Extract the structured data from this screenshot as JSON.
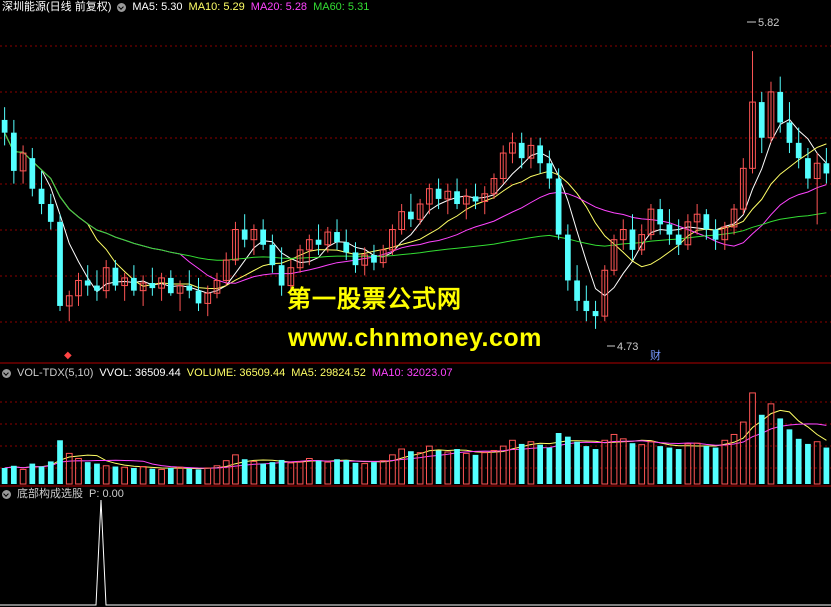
{
  "price_header": {
    "stock": "深圳能源(日线 前复权)",
    "ma5": "MA5: 5.30",
    "ma10": "MA10: 5.29",
    "ma20": "MA20: 5.28",
    "ma60": "MA60: 5.31"
  },
  "volume_header": {
    "indicator": "VOL-TDX(5,10)",
    "vvol": "VVOL: 36509.44",
    "volume": "VOLUME: 36509.44",
    "ma5": "MA5: 29824.52",
    "ma10": "MA10: 32023.07"
  },
  "signal_header": {
    "indicator": "底部构成选股",
    "p": "P: 0.00"
  },
  "annotations": {
    "high": "5.82",
    "low": "4.73",
    "marker": "财"
  },
  "watermark": {
    "line1": "第一股票公式网",
    "line2": "www.chnmoney.com"
  },
  "colors": {
    "up": "#ff5555",
    "down": "#54ffff",
    "ma5": "#ffffff",
    "ma10": "#ffff66",
    "ma20": "#ff44ff",
    "ma60": "#33dd33",
    "grid": "#8b0000"
  },
  "chart_data": [
    {
      "type": "candlestick",
      "ylim": [
        4.6,
        5.95
      ],
      "candles": [
        [
          5.55,
          5.6,
          5.45,
          5.5
        ],
        [
          5.5,
          5.55,
          5.3,
          5.35
        ],
        [
          5.35,
          5.45,
          5.3,
          5.42
        ],
        [
          5.4,
          5.44,
          5.25,
          5.28
        ],
        [
          5.28,
          5.35,
          5.18,
          5.22
        ],
        [
          5.22,
          5.26,
          5.12,
          5.15
        ],
        [
          5.15,
          5.18,
          4.8,
          4.82
        ],
        [
          4.82,
          4.88,
          4.76,
          4.86
        ],
        [
          4.86,
          4.95,
          4.82,
          4.92
        ],
        [
          4.92,
          4.98,
          4.86,
          4.9
        ],
        [
          4.9,
          4.96,
          4.84,
          4.88
        ],
        [
          4.88,
          5.0,
          4.85,
          4.97
        ],
        [
          4.97,
          5.0,
          4.88,
          4.9
        ],
        [
          4.9,
          4.95,
          4.84,
          4.93
        ],
        [
          4.93,
          4.98,
          4.86,
          4.88
        ],
        [
          4.88,
          4.94,
          4.82,
          4.91
        ],
        [
          4.91,
          4.97,
          4.86,
          4.89
        ],
        [
          4.89,
          4.95,
          4.84,
          4.93
        ],
        [
          4.93,
          4.96,
          4.86,
          4.87
        ],
        [
          4.87,
          4.92,
          4.8,
          4.9
        ],
        [
          4.9,
          4.96,
          4.85,
          4.88
        ],
        [
          4.88,
          4.93,
          4.8,
          4.83
        ],
        [
          4.83,
          4.9,
          4.78,
          4.87
        ],
        [
          4.87,
          4.95,
          4.85,
          4.92
        ],
        [
          4.92,
          5.03,
          4.9,
          5.0
        ],
        [
          5.0,
          5.15,
          4.98,
          5.12
        ],
        [
          5.12,
          5.18,
          5.05,
          5.08
        ],
        [
          5.08,
          5.14,
          5.02,
          5.12
        ],
        [
          5.12,
          5.16,
          5.04,
          5.06
        ],
        [
          5.06,
          5.1,
          4.95,
          4.98
        ],
        [
          4.98,
          5.05,
          4.86,
          4.9
        ],
        [
          4.9,
          5.0,
          4.87,
          4.97
        ],
        [
          4.97,
          5.06,
          4.95,
          5.04
        ],
        [
          5.04,
          5.1,
          4.98,
          5.08
        ],
        [
          5.08,
          5.14,
          5.02,
          5.06
        ],
        [
          5.06,
          5.13,
          5.03,
          5.11
        ],
        [
          5.11,
          5.16,
          5.04,
          5.07
        ],
        [
          5.07,
          5.12,
          5.0,
          5.03
        ],
        [
          5.03,
          5.07,
          4.95,
          4.98
        ],
        [
          4.98,
          5.05,
          4.94,
          5.02
        ],
        [
          5.02,
          5.06,
          4.96,
          4.99
        ],
        [
          4.99,
          5.06,
          4.97,
          5.04
        ],
        [
          5.04,
          5.14,
          5.02,
          5.12
        ],
        [
          5.12,
          5.22,
          5.1,
          5.19
        ],
        [
          5.19,
          5.26,
          5.13,
          5.16
        ],
        [
          5.16,
          5.24,
          5.14,
          5.22
        ],
        [
          5.22,
          5.3,
          5.18,
          5.28
        ],
        [
          5.28,
          5.32,
          5.2,
          5.24
        ],
        [
          5.24,
          5.3,
          5.18,
          5.27
        ],
        [
          5.27,
          5.32,
          5.2,
          5.22
        ],
        [
          5.22,
          5.28,
          5.16,
          5.25
        ],
        [
          5.25,
          5.3,
          5.2,
          5.23
        ],
        [
          5.23,
          5.29,
          5.18,
          5.26
        ],
        [
          5.26,
          5.34,
          5.24,
          5.32
        ],
        [
          5.32,
          5.45,
          5.3,
          5.42
        ],
        [
          5.42,
          5.5,
          5.38,
          5.46
        ],
        [
          5.46,
          5.5,
          5.36,
          5.4
        ],
        [
          5.4,
          5.48,
          5.36,
          5.45
        ],
        [
          5.45,
          5.48,
          5.34,
          5.38
        ],
        [
          5.38,
          5.43,
          5.28,
          5.32
        ],
        [
          5.32,
          5.36,
          5.08,
          5.1
        ],
        [
          5.1,
          5.14,
          4.88,
          4.92
        ],
        [
          4.92,
          4.98,
          4.8,
          4.84
        ],
        [
          4.84,
          4.9,
          4.76,
          4.8
        ],
        [
          4.8,
          4.84,
          4.73,
          4.78
        ],
        [
          4.78,
          4.98,
          4.76,
          4.96
        ],
        [
          4.96,
          5.1,
          4.94,
          5.08
        ],
        [
          5.08,
          5.16,
          5.04,
          5.12
        ],
        [
          5.12,
          5.18,
          5.0,
          5.04
        ],
        [
          5.04,
          5.14,
          5.02,
          5.1
        ],
        [
          5.1,
          5.22,
          5.08,
          5.2
        ],
        [
          5.2,
          5.24,
          5.1,
          5.14
        ],
        [
          5.14,
          5.2,
          5.06,
          5.1
        ],
        [
          5.1,
          5.16,
          5.02,
          5.06
        ],
        [
          5.06,
          5.18,
          5.04,
          5.15
        ],
        [
          5.15,
          5.22,
          5.1,
          5.18
        ],
        [
          5.18,
          5.2,
          5.08,
          5.12
        ],
        [
          5.12,
          5.16,
          5.04,
          5.08
        ],
        [
          5.08,
          5.15,
          5.04,
          5.13
        ],
        [
          5.13,
          5.22,
          5.1,
          5.2
        ],
        [
          5.2,
          5.4,
          5.18,
          5.36
        ],
        [
          5.36,
          5.82,
          5.34,
          5.62
        ],
        [
          5.62,
          5.66,
          5.42,
          5.48
        ],
        [
          5.48,
          5.7,
          5.46,
          5.66
        ],
        [
          5.66,
          5.72,
          5.5,
          5.54
        ],
        [
          5.54,
          5.62,
          5.42,
          5.46
        ],
        [
          5.46,
          5.52,
          5.36,
          5.4
        ],
        [
          5.4,
          5.44,
          5.28,
          5.32
        ],
        [
          5.32,
          5.42,
          5.14,
          5.38
        ],
        [
          5.38,
          5.44,
          5.3,
          5.34
        ]
      ],
      "annotations": [
        {
          "label": "5.82"
        },
        {
          "label": "4.73"
        }
      ]
    },
    {
      "type": "bar",
      "ylim": [
        0,
        140000
      ],
      "values": [
        22000,
        25000,
        20000,
        28000,
        24000,
        31000,
        60000,
        42000,
        35000,
        30000,
        28000,
        25000,
        24000,
        23000,
        22000,
        24000,
        21000,
        20000,
        22000,
        23000,
        21000,
        20000,
        22000,
        25000,
        32000,
        40000,
        34000,
        31000,
        28000,
        30000,
        33000,
        29000,
        30000,
        35000,
        32000,
        30000,
        34000,
        33000,
        29000,
        28000,
        30000,
        32000,
        40000,
        48000,
        45000,
        43000,
        52000,
        46000,
        44000,
        48000,
        42000,
        40000,
        43000,
        46000,
        52000,
        60000,
        55000,
        58000,
        54000,
        50000,
        70000,
        65000,
        58000,
        52000,
        48000,
        60000,
        68000,
        62000,
        56000,
        54000,
        58000,
        52000,
        50000,
        48000,
        55000,
        56000,
        52000,
        50000,
        60000,
        68000,
        85000,
        125000,
        95000,
        110000,
        90000,
        75000,
        62000,
        55000,
        58000,
        50000
      ]
    }
  ]
}
